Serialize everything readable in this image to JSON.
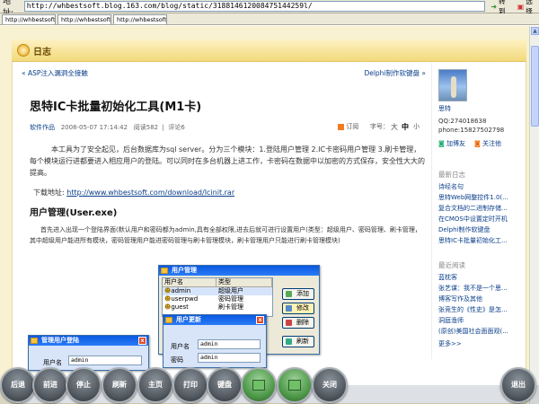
{
  "browser": {
    "address_label": "地址:",
    "url": "http://whbestsoft.blog.163.com/blog/static/318814612008475144259l/",
    "go_label": "转到",
    "select_label": "选择",
    "tabs": [
      "http://whbestsoft...",
      "http://whbestsoft...",
      "http://whbestsoft..."
    ]
  },
  "blog": {
    "section_title": "日志",
    "prev_link": "ASP注入漏洞全接触",
    "next_link": "Delphi制作软键盘",
    "title": "思特IC卡批量初始化工具(M1卡)",
    "category": "软件作品",
    "date": "2008-05-07 17:14:42",
    "reads": "阅读582",
    "comments": "评论6",
    "subscribe": "订阅",
    "fontsize_label": "字号：",
    "font_big": "大",
    "font_mid": "中",
    "font_small": "小",
    "intro": "本工具为了安全起见，后台数据库为sql server。分为三个模块：1.登陆用户管理  2.IC卡密码用户管理  3.刷卡管理，每个模块运行进都要进入相应用户的登陆。可以同时在多台机器上进工作，卡密码在数据中以加密的方式保存，安全性大大的提高。",
    "download_label": "下载地址:",
    "download_url": "http://www.whbestsoft.com/download/Icinit.rar",
    "section2": "用户管理(User.exe)",
    "para2": "首先进入出现一个登陆界面(默认用户和密码都为admin,具有全部权限,进去后就可进行设置用户(类型：超级用户、密码管理、刷卡管理，其中超级用户能进所有模块，密码管理用户能进密码管理与刷卡管理模块，刷卡管理用户只能进行刷卡管理模块)"
  },
  "sidebar": {
    "name": "思特",
    "qq": "QQ:274018638",
    "phone": "phone:15827502798",
    "add_friend": "加博友",
    "follow": "关注他",
    "recent_head": "最新日志",
    "recent": [
      "诗经名句",
      "思特Web网整控件1.0(...",
      "复合文档的二进制存储...",
      "在CMOS中设置定时开机",
      "Delphi制作软键盘",
      "思特IC卡批量初始化工..."
    ],
    "readers_head": "最近阅读",
    "readers": [
      "蓝枕客",
      "张艺谋：我不是一个思...",
      "博客写作及其他",
      "张竞生的《性史》是怎...",
      "洞庭渔师",
      "(原创)美国社会面面观(...",
      "更多>>"
    ]
  },
  "usermgr": {
    "title": "用户管理",
    "col_user": "用户名",
    "col_type": "类型",
    "rows": [
      {
        "user": "admin",
        "type": "超级用户"
      },
      {
        "user": "userpwd",
        "type": "密码管理"
      },
      {
        "user": "guest",
        "type": "刷卡管理"
      }
    ],
    "add": "添加",
    "edit": "修改",
    "delete": "删除",
    "refresh": "刷新"
  },
  "userupdate": {
    "title": "用户更新",
    "user_label": "用户名",
    "user_value": "admin",
    "pwd_label": "密码",
    "pwd_value": "admin",
    "type_label": "类别",
    "type_value": "超级用户"
  },
  "login": {
    "title": "管理用户登陆",
    "user_label": "用户名",
    "user_value": "admin",
    "pwd_value": "****"
  },
  "dock": [
    "后退",
    "前进",
    "停止",
    "刷新",
    "主页",
    "打印",
    "键盘",
    "",
    "",
    "关闭",
    "退出"
  ]
}
